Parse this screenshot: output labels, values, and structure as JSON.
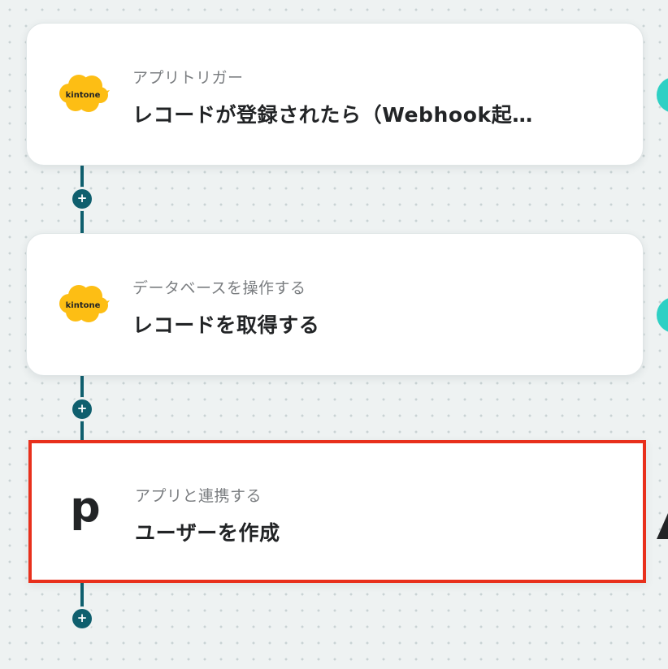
{
  "flow": {
    "steps": [
      {
        "category": "アプリトリガー",
        "title": "レコードが登録されたら（Webhook起…",
        "app_icon": "kintone-logo",
        "app_label": "kintone"
      },
      {
        "category": "データベースを操作する",
        "title": "レコードを取得する",
        "app_icon": "kintone-logo",
        "app_label": "kintone"
      },
      {
        "category": "アプリと連携する",
        "title": "ユーザーを作成",
        "app_icon": "p-logo",
        "app_label": "p",
        "selected": true
      }
    ],
    "add_button_icon": "plus-icon",
    "colors": {
      "connector": "#0f5f6e",
      "selection_border": "#e8301c",
      "kintone_yellow": "#fdbe14",
      "side_node": "#2ed0c4",
      "background": "#eef2f2"
    }
  }
}
